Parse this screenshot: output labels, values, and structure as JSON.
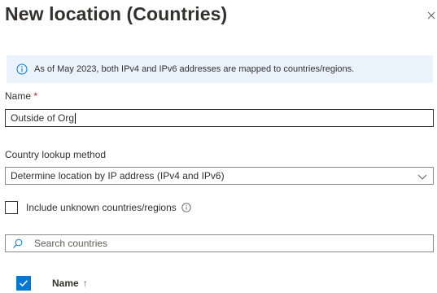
{
  "panel": {
    "title": "New location (Countries)",
    "close_icon": "close-icon"
  },
  "info_bar": {
    "icon": "info-icon",
    "text": "As of May 2023, both IPv4 and IPv6 addresses are mapped to countries/regions."
  },
  "name_field": {
    "label": "Name",
    "required_marker": "*",
    "value": "Outside of Org"
  },
  "lookup_method": {
    "label": "Country lookup method",
    "selected": "Determine location by IP address (IPv4 and IPv6)",
    "icon": "chevron-down-icon"
  },
  "unknown_countries": {
    "label": "Include unknown countries/regions",
    "checked": false,
    "icon": "info-icon"
  },
  "search": {
    "placeholder": "Search countries",
    "icon": "search-icon"
  },
  "table": {
    "select_all_checked": true,
    "column_name": "Name",
    "sort_indicator": "↑"
  },
  "colors": {
    "accent": "#0078d4",
    "info_background": "#eaf3fc",
    "required": "#a4262c"
  }
}
